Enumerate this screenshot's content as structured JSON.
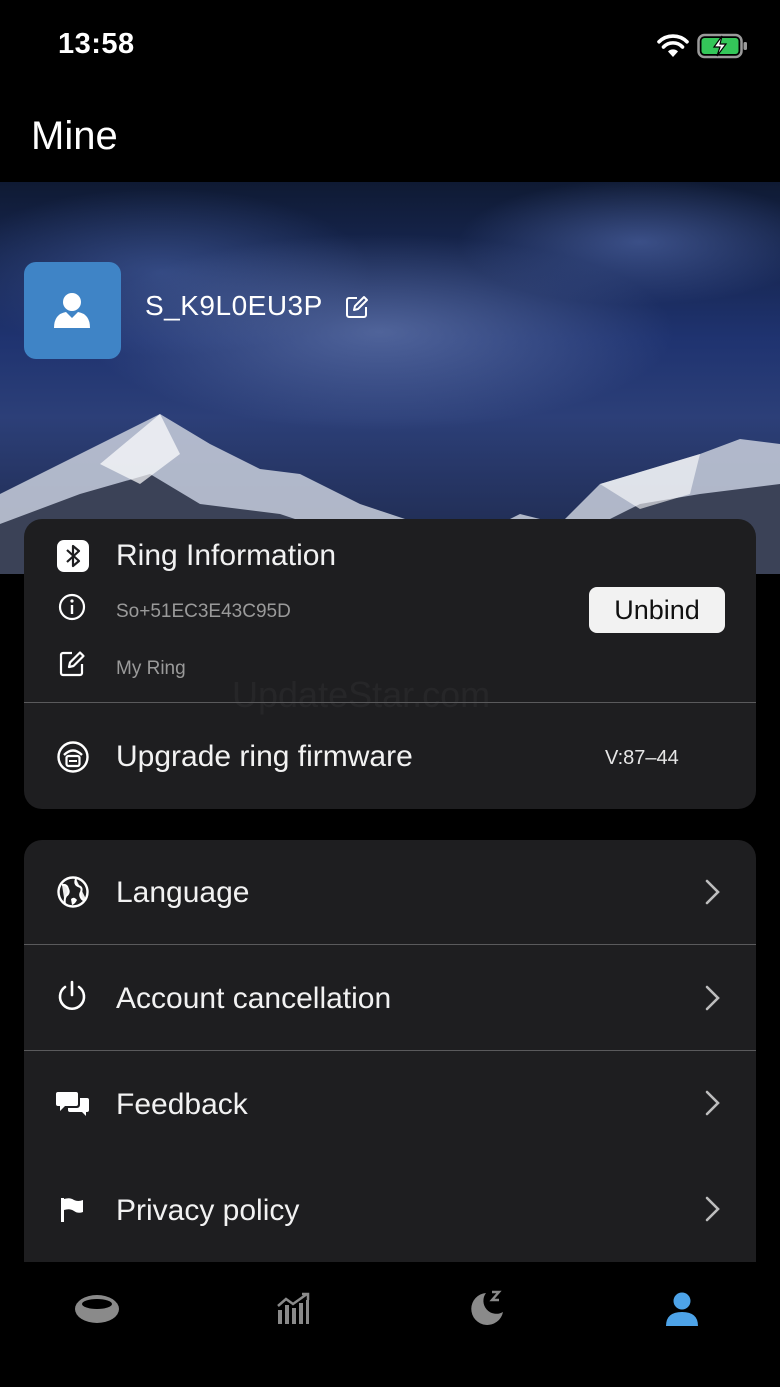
{
  "status_bar": {
    "time": "13:58",
    "wifi_icon": "wifi-icon",
    "battery_icon": "battery-charging-icon"
  },
  "header": {
    "title": "Mine"
  },
  "profile": {
    "avatar_icon": "user-avatar-icon",
    "username": "S_K9L0EU3P",
    "edit_icon": "edit-icon"
  },
  "ring": {
    "title": "Ring Information",
    "title_icon": "bluetooth-icon",
    "id": "So+51EC3E43C95D",
    "id_icon": "info-icon",
    "name": "My Ring",
    "name_icon": "edit-icon",
    "unbind_label": "Unbind",
    "firmware_label": "Upgrade ring firmware",
    "firmware_icon": "firmware-icon",
    "firmware_version": "V:87–44"
  },
  "watermark": "UpdateStar.com",
  "menu": [
    {
      "label": "Language",
      "icon": "globe-icon"
    },
    {
      "label": "Account cancellation",
      "icon": "power-icon"
    },
    {
      "label": "Feedback",
      "icon": "chat-bubbles-icon"
    },
    {
      "label": "Privacy policy",
      "icon": "flag-icon"
    }
  ],
  "tabbar": [
    {
      "icon": "ring-icon",
      "active": false
    },
    {
      "icon": "stats-chart-icon",
      "active": false
    },
    {
      "icon": "sleep-moon-icon",
      "active": false
    },
    {
      "icon": "profile-icon",
      "active": true
    }
  ],
  "colors": {
    "background": "#000000",
    "card": "#1e1e20",
    "avatar": "#3f84c6",
    "active_tab": "#4da3e8",
    "inactive_tab": "#8a8a8a"
  }
}
